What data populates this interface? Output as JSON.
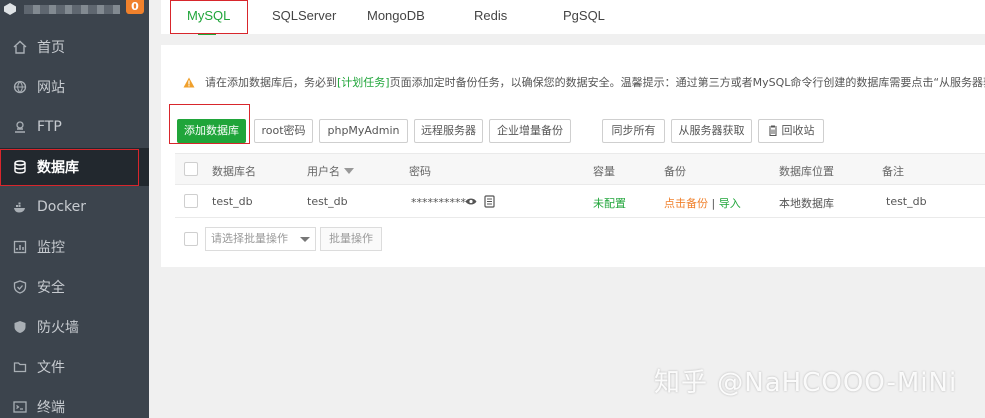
{
  "sidebar": {
    "badge": "0",
    "items": [
      {
        "label": "首页",
        "icon": "home-icon"
      },
      {
        "label": "网站",
        "icon": "globe-icon"
      },
      {
        "label": "FTP",
        "icon": "ftp-icon"
      },
      {
        "label": "数据库",
        "icon": "database-icon",
        "active": true
      },
      {
        "label": "Docker",
        "icon": "docker-icon"
      },
      {
        "label": "监控",
        "icon": "monitor-icon"
      },
      {
        "label": "安全",
        "icon": "shield-icon"
      },
      {
        "label": "防火墙",
        "icon": "firewall-icon"
      },
      {
        "label": "文件",
        "icon": "folder-icon"
      },
      {
        "label": "终端",
        "icon": "terminal-icon"
      }
    ]
  },
  "tabs": [
    {
      "label": "MySQL",
      "active": true
    },
    {
      "label": "SQLServer"
    },
    {
      "label": "MongoDB"
    },
    {
      "label": "Redis"
    },
    {
      "label": "PgSQL"
    }
  ],
  "warning": {
    "before": "请在添加数据库后，务必到",
    "link": "[计划任务]",
    "after": "页面添加定时备份任务，以确保您的数据安全。温馨提示：通过第三方或者MySQL命令行创建的数据库需要点击“从服务器获取”"
  },
  "toolbar": {
    "add_db": "添加数据库",
    "root_pwd": "root密码",
    "phpmyadmin": "phpMyAdmin",
    "remote_server": "远程服务器",
    "enterprise_backup": "企业增量备份",
    "sync_all": "同步所有",
    "fetch_from_server": "从服务器获取",
    "recycle_bin": "回收站"
  },
  "table": {
    "headers": {
      "name": "数据库名",
      "user": "用户名",
      "password": "密码",
      "capacity": "容量",
      "backup": "备份",
      "location": "数据库位置",
      "remark": "备注"
    },
    "rows": [
      {
        "name": "test_db",
        "user": "test_db",
        "password": "**********",
        "capacity": "未配置",
        "backup_action": "点击备份",
        "separator": "|",
        "import": "导入",
        "location": "本地数据库",
        "remark": "test_db"
      }
    ]
  },
  "batch": {
    "placeholder": "请选择批量操作",
    "button": "批量操作"
  },
  "watermark": "知乎 @NaHCOOO-MiNi",
  "colors": {
    "accent": "#20a53a",
    "sidebar_bg": "#3c444d",
    "highlight": "#d8262c",
    "warning": "#f0a02c"
  }
}
